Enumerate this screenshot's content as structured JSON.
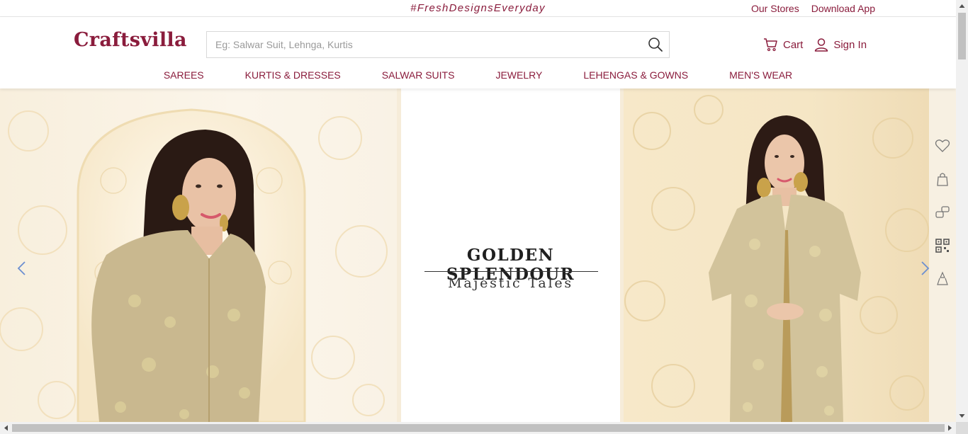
{
  "topbar": {
    "tagline": "#FreshDesignsEveryday",
    "links": [
      "Our Stores",
      "Download App"
    ]
  },
  "header": {
    "logo": "Craftsvilla",
    "search_placeholder": "Eg: Salwar Suit, Lehnga, Kurtis",
    "cart_label": "Cart",
    "signin_label": "Sign In"
  },
  "nav": {
    "items": [
      "SAREES",
      "KURTIS & DRESSES",
      "SALWAR SUITS",
      "JEWELRY",
      "LEHENGAS & GOWNS",
      "MEN'S WEAR"
    ]
  },
  "hero": {
    "headline": "GOLDEN SPLENDOUR",
    "subline": "Majestic Tales"
  },
  "side_rail": {
    "icons": [
      "heart-icon",
      "shopping-bag-icon",
      "chat-icon",
      "qr-code-icon",
      "stack-icon"
    ]
  },
  "colors": {
    "brand": "#8a1c3c",
    "arrow": "#6c8fd0"
  }
}
